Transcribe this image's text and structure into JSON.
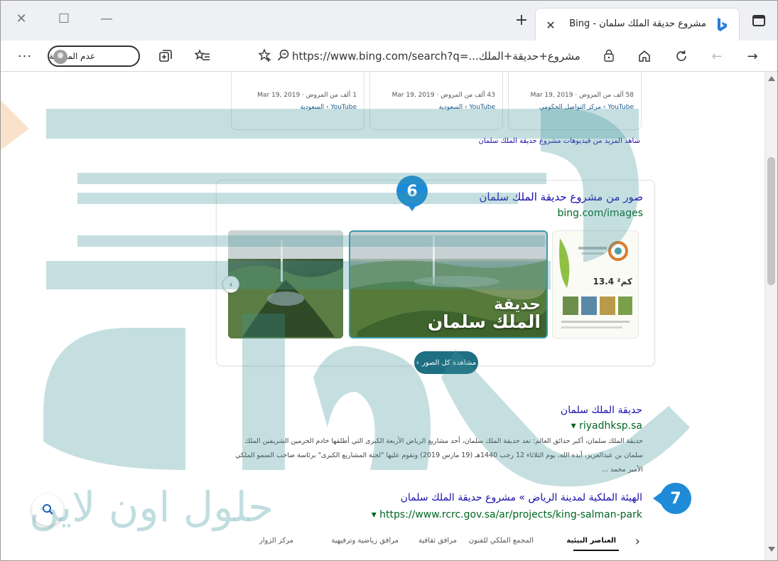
{
  "browser": {
    "tab_title": "مشروع حديقة الملك سلمان - Bing",
    "url": "https://www.bing.com/search?q=...مشروع+حديقة+الملك",
    "sync_label": "عدم المزامنة",
    "more_label": "···"
  },
  "videos": [
    {
      "meta": "58 ألف من المروض · Mar 19, 2019",
      "source": "YouTube › مركز التواصل الحكومي"
    },
    {
      "meta": "43 ألف من المروض · Mar 19, 2019",
      "source": "YouTube › السعودية"
    },
    {
      "meta": "1 ألف من المروض · Mar 19, 2019",
      "source": "YouTube › السعودية"
    }
  ],
  "more_videos_link": "شاهد المزيد من فيديوهات مشروع حديقة الملك سلمان",
  "images": {
    "title": "صور من مشروع حديقة الملك سلمان",
    "source": "bing.com/images",
    "caption_line1": "حديقة",
    "caption_line2": "الملك سلمان",
    "area_badge": "13.4 كم²",
    "see_all_label": "مشاهدة كل الصور"
  },
  "results": [
    {
      "title": "حديقة الملك سلمان",
      "url": "riyadhksp.sa",
      "snippet": "حديقة الملك سلمان، أكبر حدائق العالم: تعد حديقة الملك سلمان، أحد مشاريع الرياض الأربعة الكبرى التي أطلقها خادم الحرمين الشريفين الملك سلمان بن عبدالعزيز، أيده الله، يوم الثلاثاء 12 رجب 1440هـ (19 مارس 2019) وتقوم عليها \"لجنة المشاريع الكبرى\" برئاسة صاحب السمو الملكي الأمير محمد ..."
    },
    {
      "title": "الهيئة الملكية لمدينة الرياض » مشروع حديقة الملك سلمان",
      "url": "https://www.rcrc.gov.sa/ar/projects/king-salman-park"
    }
  ],
  "sub_tabs": [
    "العناصر البيئية",
    "المجمع الملكي للفنون",
    "مرافق ثقافية",
    "مرافق رياضية وترفيهية",
    "مركز الزوار"
  ],
  "markers": {
    "m6": "6",
    "m7": "7"
  },
  "watermark": "حلول اون لاين",
  "colors": {
    "accent": "#1d8bd8",
    "link": "#1a0dab",
    "url_green": "#006621",
    "teal_button": "#1f6f82"
  }
}
